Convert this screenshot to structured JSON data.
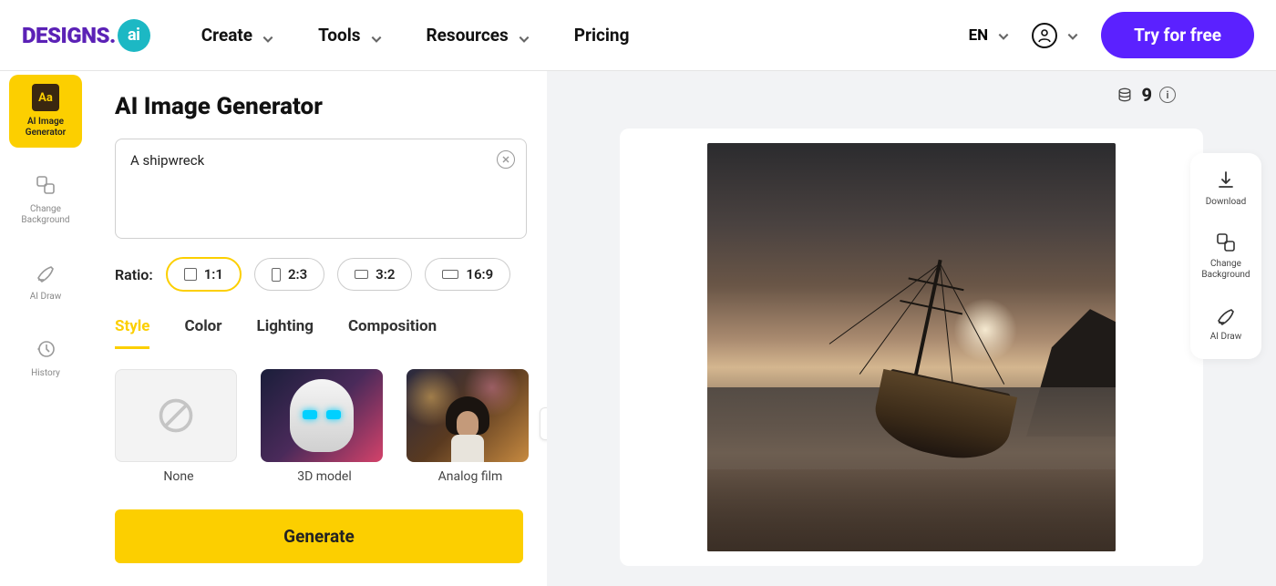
{
  "header": {
    "logo_text": "DESIGNS.",
    "logo_badge": "ai",
    "nav": {
      "create": "Create",
      "tools": "Tools",
      "resources": "Resources",
      "pricing": "Pricing"
    },
    "lang": "EN",
    "cta": "Try for free"
  },
  "sidebar": {
    "items": [
      {
        "icon": "Aa",
        "label": "AI Image Generator"
      },
      {
        "icon": "swap",
        "label": "Change Background"
      },
      {
        "icon": "pen",
        "label": "AI Draw"
      },
      {
        "icon": "history",
        "label": "History"
      }
    ]
  },
  "panel": {
    "title": "AI Image Generator",
    "prompt": "A shipwreck",
    "ratio_label": "Ratio:",
    "ratios": [
      "1:1",
      "2:3",
      "3:2",
      "16:9"
    ],
    "tabs": [
      "Style",
      "Color",
      "Lighting",
      "Composition"
    ],
    "styles": [
      {
        "label": "None"
      },
      {
        "label": "3D model"
      },
      {
        "label": "Analog film"
      }
    ],
    "generate": "Generate"
  },
  "canvas": {
    "credits": "9"
  },
  "rightbar": {
    "items": [
      {
        "label": "Download"
      },
      {
        "label": "Change Background"
      },
      {
        "label": "AI Draw"
      }
    ]
  }
}
